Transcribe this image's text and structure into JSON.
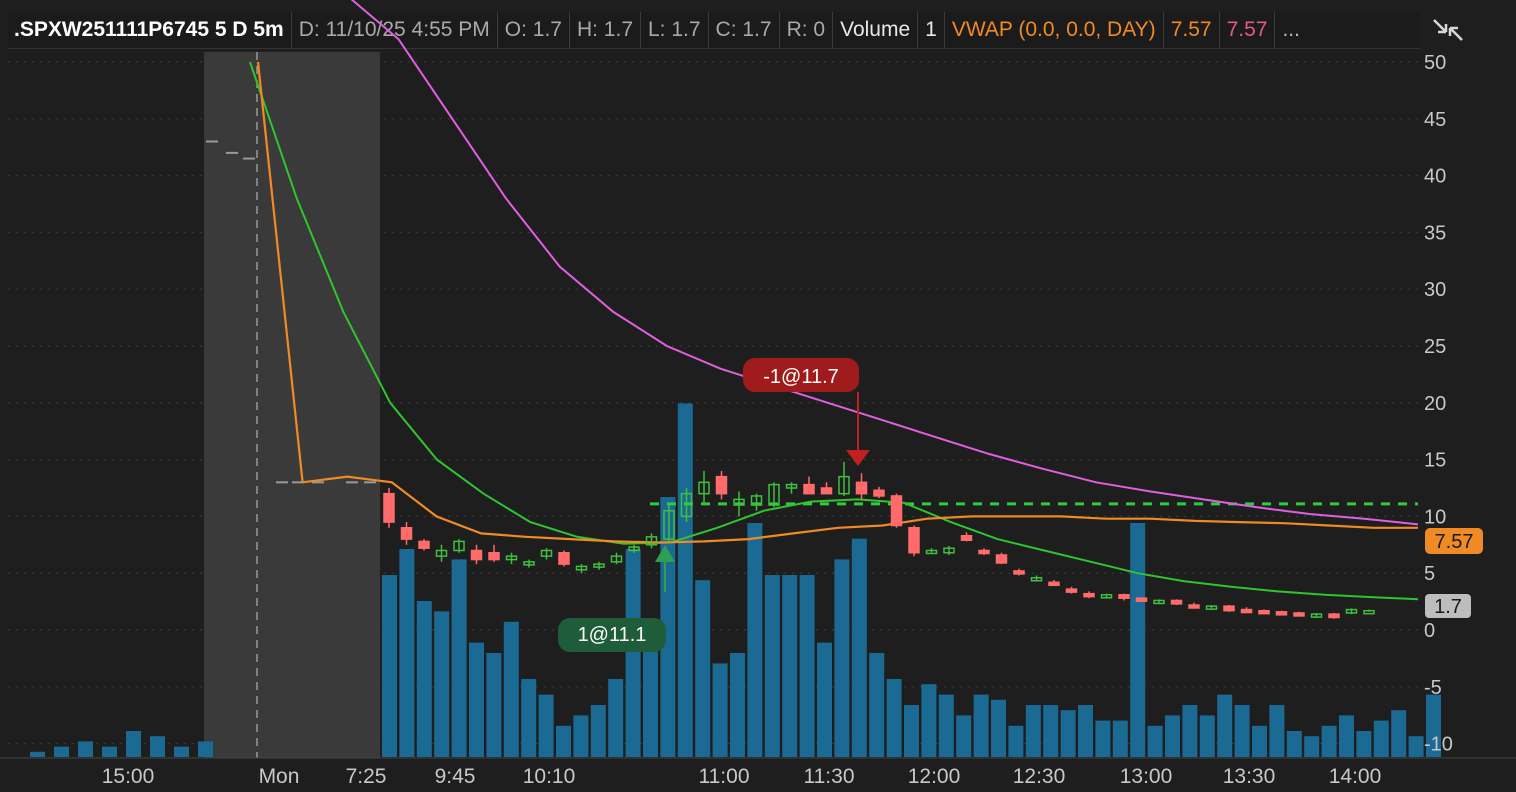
{
  "header": {
    "symbol": ".SPXW251111P6745 5 D 5m",
    "date": "D: 11/10/25 4:55 PM",
    "open": "O: 1.7",
    "high": "H: 1.7",
    "low": "L: 1.7",
    "close": "C: 1.7",
    "range": "R: 0",
    "volume_label": "Volume",
    "volume_value": "1",
    "vwap_label": "VWAP (0.0, 0.0, DAY)",
    "vwap_value1": "7.57",
    "vwap_value2": "7.57",
    "more": "..."
  },
  "icons": {
    "toolbar": "collapse-arrows-icon"
  },
  "colors": {
    "bg": "#1e1e1e",
    "up": "#3fbf3f",
    "down": "#ff6b6b",
    "volume": "#1b6a94",
    "vwap": "#f08a24",
    "ma_fast": "#2ec52e",
    "ma_slow": "#e05fe0",
    "premarket": "#3a3a3a"
  },
  "chart_data": {
    "type": "candlestick",
    "y_ticks": [
      "50",
      "45",
      "40",
      "35",
      "30",
      "25",
      "20",
      "15",
      "10",
      "5",
      "0",
      "-5",
      "-10"
    ],
    "y_range": [
      -11,
      51
    ],
    "x_ticks": [
      "15:00",
      "Mon",
      "7:25",
      "9:45",
      "10:10",
      "11:00",
      "11:30",
      "12:00",
      "12:30",
      "13:00",
      "13:30",
      "14:00"
    ],
    "price_tags": [
      {
        "label": "7.57",
        "value": 7.57,
        "color": "#f08a24"
      },
      {
        "label": "1.7",
        "value": 1.7,
        "color": "#bdbdbd"
      }
    ],
    "trades": [
      {
        "label": "1@11.1",
        "side": "buy",
        "price": 11.1
      },
      {
        "label": "-1@11.7",
        "side": "sell",
        "price": 11.7
      }
    ],
    "reference_line": 11.1,
    "candles": [
      {
        "o": 43,
        "h": 43,
        "l": 43,
        "c": 43
      },
      {
        "o": 42,
        "h": 42,
        "l": 42,
        "c": 42
      },
      {
        "o": 41.5,
        "h": 41.5,
        "l": 41.5,
        "c": 41.5
      },
      {
        "o": 13,
        "h": 13,
        "l": 13,
        "c": 13
      },
      {
        "o": 13,
        "h": 13,
        "l": 13,
        "c": 13
      },
      {
        "o": 13,
        "h": 13,
        "l": 13,
        "c": 13
      },
      {
        "o": 13,
        "h": 13,
        "l": 13,
        "c": 13
      },
      {
        "o": 13,
        "h": 13,
        "l": 13,
        "c": 13
      },
      {
        "o": 12,
        "h": 12.5,
        "l": 9,
        "c": 9.5
      },
      {
        "o": 9,
        "h": 9.5,
        "l": 7.5,
        "c": 8
      },
      {
        "o": 7.8,
        "h": 8,
        "l": 7,
        "c": 7.2
      },
      {
        "o": 6.5,
        "h": 7.5,
        "l": 6,
        "c": 7
      },
      {
        "o": 7,
        "h": 8,
        "l": 6.8,
        "c": 7.8
      },
      {
        "o": 7,
        "h": 7.5,
        "l": 5.8,
        "c": 6.2
      },
      {
        "o": 6.8,
        "h": 7.5,
        "l": 6,
        "c": 6.2
      },
      {
        "o": 6.2,
        "h": 6.8,
        "l": 5.8,
        "c": 6.5
      },
      {
        "o": 5.8,
        "h": 6.2,
        "l": 5.5,
        "c": 6
      },
      {
        "o": 6.5,
        "h": 7.2,
        "l": 6.2,
        "c": 7
      },
      {
        "o": 6.8,
        "h": 7,
        "l": 5.6,
        "c": 5.8
      },
      {
        "o": 5.3,
        "h": 5.8,
        "l": 5,
        "c": 5.6
      },
      {
        "o": 5.6,
        "h": 6,
        "l": 5.3,
        "c": 5.8
      },
      {
        "o": 6,
        "h": 6.8,
        "l": 5.8,
        "c": 6.5
      },
      {
        "o": 7,
        "h": 7.5,
        "l": 6.8,
        "c": 7.3
      },
      {
        "o": 7.5,
        "h": 8.5,
        "l": 7.2,
        "c": 8.2
      },
      {
        "o": 8,
        "h": 11,
        "l": 7.8,
        "c": 10.5
      },
      {
        "o": 10,
        "h": 12.5,
        "l": 9.5,
        "c": 12
      },
      {
        "o": 12,
        "h": 14,
        "l": 11,
        "c": 13
      },
      {
        "o": 13.5,
        "h": 14,
        "l": 11.5,
        "c": 12
      },
      {
        "o": 11,
        "h": 12.2,
        "l": 10,
        "c": 11.5
      },
      {
        "o": 11,
        "h": 12,
        "l": 10.5,
        "c": 11.8
      },
      {
        "o": 11,
        "h": 13,
        "l": 10.8,
        "c": 12.8
      },
      {
        "o": 12.5,
        "h": 13,
        "l": 12,
        "c": 12.8
      },
      {
        "o": 12.8,
        "h": 13.5,
        "l": 12.5,
        "c": 12
      },
      {
        "o": 12.5,
        "h": 13,
        "l": 12,
        "c": 12
      },
      {
        "o": 12,
        "h": 14.8,
        "l": 11.8,
        "c": 13.5
      },
      {
        "o": 13,
        "h": 13.8,
        "l": 11.5,
        "c": 12
      },
      {
        "o": 12.3,
        "h": 12.6,
        "l": 11.6,
        "c": 11.8
      },
      {
        "o": 11.8,
        "h": 12,
        "l": 9,
        "c": 9.2
      },
      {
        "o": 9,
        "h": 9.2,
        "l": 6.5,
        "c": 6.8
      },
      {
        "o": 7,
        "h": 7.2,
        "l": 6.8,
        "c": 7
      },
      {
        "o": 6.8,
        "h": 7.4,
        "l": 6.6,
        "c": 7.2
      },
      {
        "o": 8.3,
        "h": 8.6,
        "l": 7.8,
        "c": 7.9
      },
      {
        "o": 7,
        "h": 7.2,
        "l": 6.6,
        "c": 6.8
      },
      {
        "o": 6.6,
        "h": 6.8,
        "l": 5.8,
        "c": 5.9
      },
      {
        "o": 5.2,
        "h": 5.4,
        "l": 4.8,
        "c": 5
      },
      {
        "o": 4.5,
        "h": 4.8,
        "l": 4.4,
        "c": 4.6
      },
      {
        "o": 4.2,
        "h": 4.4,
        "l": 3.9,
        "c": 4
      },
      {
        "o": 3.6,
        "h": 3.8,
        "l": 3.2,
        "c": 3.4
      },
      {
        "o": 3.2,
        "h": 3.4,
        "l": 2.8,
        "c": 3
      },
      {
        "o": 3,
        "h": 3.2,
        "l": 2.9,
        "c": 3.1
      },
      {
        "o": 3.1,
        "h": 3.2,
        "l": 2.6,
        "c": 2.8
      },
      {
        "o": 2.8,
        "h": 2.9,
        "l": 2.5,
        "c": 2.6
      },
      {
        "o": 2.4,
        "h": 2.7,
        "l": 2.3,
        "c": 2.6
      },
      {
        "o": 2.6,
        "h": 2.7,
        "l": 2.2,
        "c": 2.3
      },
      {
        "o": 2.2,
        "h": 2.4,
        "l": 2,
        "c": 2.1
      },
      {
        "o": 2,
        "h": 2.2,
        "l": 1.9,
        "c": 2.1
      },
      {
        "o": 2.1,
        "h": 2.2,
        "l": 1.6,
        "c": 1.7
      },
      {
        "o": 1.8,
        "h": 2,
        "l": 1.6,
        "c": 1.7
      },
      {
        "o": 1.7,
        "h": 1.8,
        "l": 1.5,
        "c": 1.6
      },
      {
        "o": 1.6,
        "h": 1.7,
        "l": 1.4,
        "c": 1.5
      },
      {
        "o": 1.5,
        "h": 1.6,
        "l": 1.2,
        "c": 1.3
      },
      {
        "o": 1.3,
        "h": 1.5,
        "l": 1.2,
        "c": 1.4
      },
      {
        "o": 1.4,
        "h": 1.5,
        "l": 1,
        "c": 1.1
      },
      {
        "o": 1.5,
        "h": 1.9,
        "l": 1.4,
        "c": 1.8
      },
      {
        "o": 1.7,
        "h": 1.8,
        "l": 1.6,
        "c": 1.7
      }
    ],
    "volume": [
      1,
      2,
      3,
      2,
      5,
      4,
      2,
      3,
      35,
      40,
      30,
      28,
      38,
      22,
      20,
      26,
      15,
      12,
      6,
      8,
      10,
      15,
      40,
      25,
      50,
      68,
      34,
      18,
      20,
      45,
      35,
      35,
      35,
      22,
      38,
      42,
      20,
      15,
      10,
      14,
      12,
      8,
      12,
      11,
      6,
      10,
      10,
      9,
      10,
      7,
      7,
      45,
      6,
      8,
      10,
      8,
      12,
      10,
      6,
      10,
      5,
      4,
      6,
      8,
      5,
      7,
      9,
      4,
      12
    ],
    "vwap_line": [
      50,
      13,
      13.5,
      13,
      10,
      8.5,
      8.2,
      8,
      7.8,
      7.7,
      7.8,
      8,
      8.5,
      9,
      9.2,
      9.8,
      10,
      10,
      10,
      9.8,
      9.8,
      9.6,
      9.5,
      9.4,
      9.2,
      9,
      9
    ],
    "ma_fast_line": [
      50,
      38,
      28,
      20,
      15,
      12,
      9.5,
      8.2,
      7.6,
      7.7,
      9,
      10.5,
      11.3,
      11.5,
      11.2,
      9.5,
      8,
      7,
      6,
      5,
      4.3,
      3.8,
      3.4,
      3.1,
      2.9,
      2.7
    ],
    "ma_slow_line": [
      56,
      52,
      45,
      38,
      32,
      28,
      25,
      23,
      21.5,
      20,
      18.5,
      17,
      15.5,
      14.2,
      13,
      12.2,
      11.5,
      10.8,
      10.2,
      9.8,
      9.3
    ]
  }
}
